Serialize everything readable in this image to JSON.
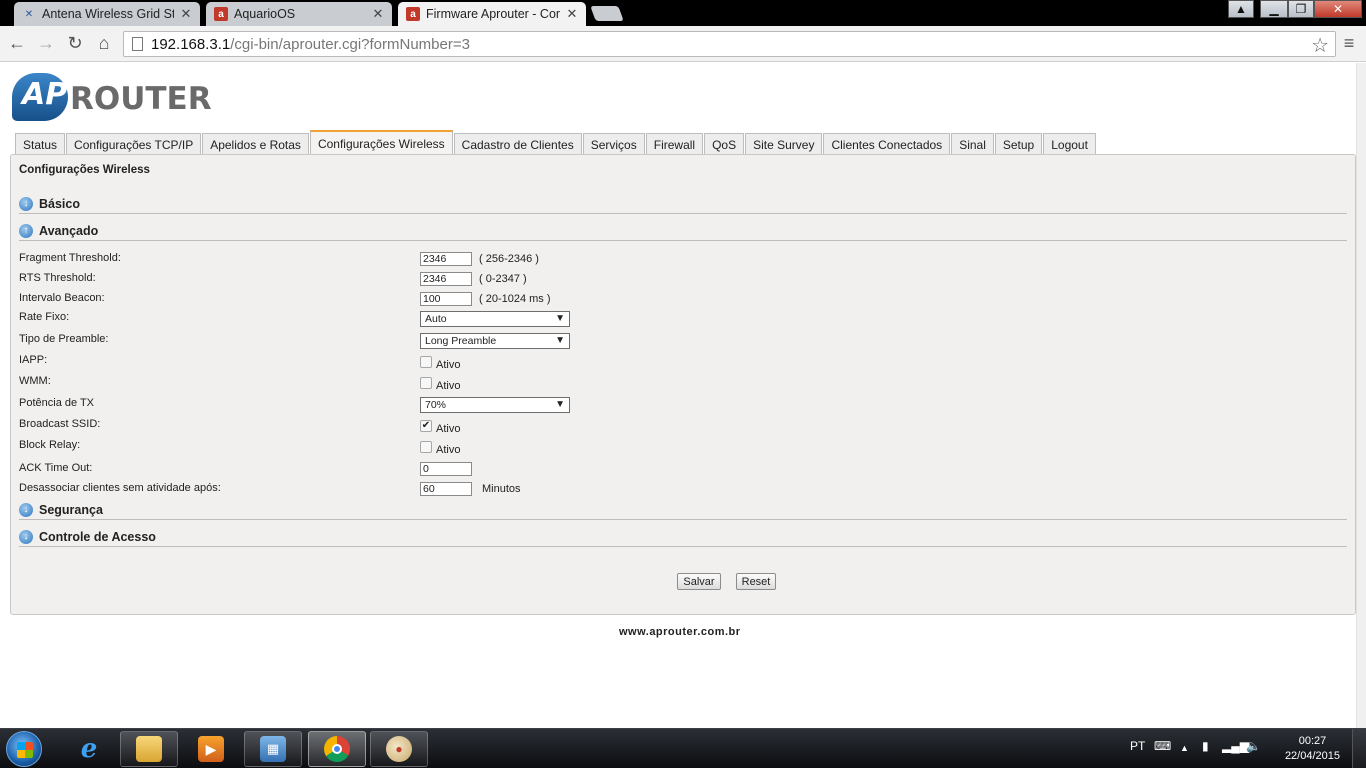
{
  "browser": {
    "tabs": [
      {
        "label": "Antena Wireless Grid Stati",
        "favicon": "x-icon",
        "active": false
      },
      {
        "label": "AquarioOS",
        "favicon": "aprouter-icon",
        "active": false
      },
      {
        "label": "Firmware Aprouter - Conf",
        "favicon": "aprouter-icon",
        "active": true
      }
    ],
    "url_host": "192.168.3.1",
    "url_path": "/cgi-bin/aprouter.cgi?formNumber=3"
  },
  "logo": {
    "wordmark": "ROUTER",
    "mark_letters": "AP"
  },
  "nav_tabs": [
    {
      "label": "Status"
    },
    {
      "label": "Configurações TCP/IP"
    },
    {
      "label": "Apelidos e Rotas"
    },
    {
      "label": "Configurações Wireless",
      "active": true
    },
    {
      "label": "Cadastro de Clientes"
    },
    {
      "label": "Serviços"
    },
    {
      "label": "Firewall"
    },
    {
      "label": "QoS"
    },
    {
      "label": "Site Survey"
    },
    {
      "label": "Clientes Conectados"
    },
    {
      "label": "Sinal"
    },
    {
      "label": "Setup"
    },
    {
      "label": "Logout"
    }
  ],
  "panel": {
    "title": "Configurações Wireless",
    "sections": {
      "basico": "Básico",
      "avancado": "Avançado",
      "seguranca": "Segurança",
      "controle": "Controle de Acesso"
    },
    "fields": {
      "fragment": {
        "label": "Fragment Threshold:",
        "value": "2346",
        "hint": "( 256-2346 )"
      },
      "rts": {
        "label": "RTS Threshold:",
        "value": "2346",
        "hint": "( 0-2347 )"
      },
      "beacon": {
        "label": "Intervalo Beacon:",
        "value": "100",
        "hint": "( 20-1024 ms )"
      },
      "rate": {
        "label": "Rate Fixo:",
        "selected": "Auto"
      },
      "preamble": {
        "label": "Tipo de Preamble:",
        "selected": "Long Preamble"
      },
      "iapp": {
        "label": "IAPP:",
        "checked": false,
        "check_label": "Ativo"
      },
      "wmm": {
        "label": "WMM:",
        "checked": false,
        "check_label": "Ativo"
      },
      "txpower": {
        "label": "Potência de TX",
        "selected": "70%"
      },
      "broadcast": {
        "label": "Broadcast SSID:",
        "checked": true,
        "check_label": "Ativo"
      },
      "blockrelay": {
        "label": "Block Relay:",
        "checked": false,
        "check_label": "Ativo"
      },
      "ack": {
        "label": "ACK Time Out:",
        "value": "0"
      },
      "disassoc": {
        "label": "Desassociar clientes sem atividade após:",
        "value": "60",
        "unit": "Minutos"
      }
    },
    "buttons": {
      "save": "Salvar",
      "reset": "Reset"
    }
  },
  "footer": {
    "link": "www.aprouter.com.br"
  },
  "taskbar": {
    "language": "PT",
    "time": "00:27",
    "date": "22/04/2015"
  }
}
